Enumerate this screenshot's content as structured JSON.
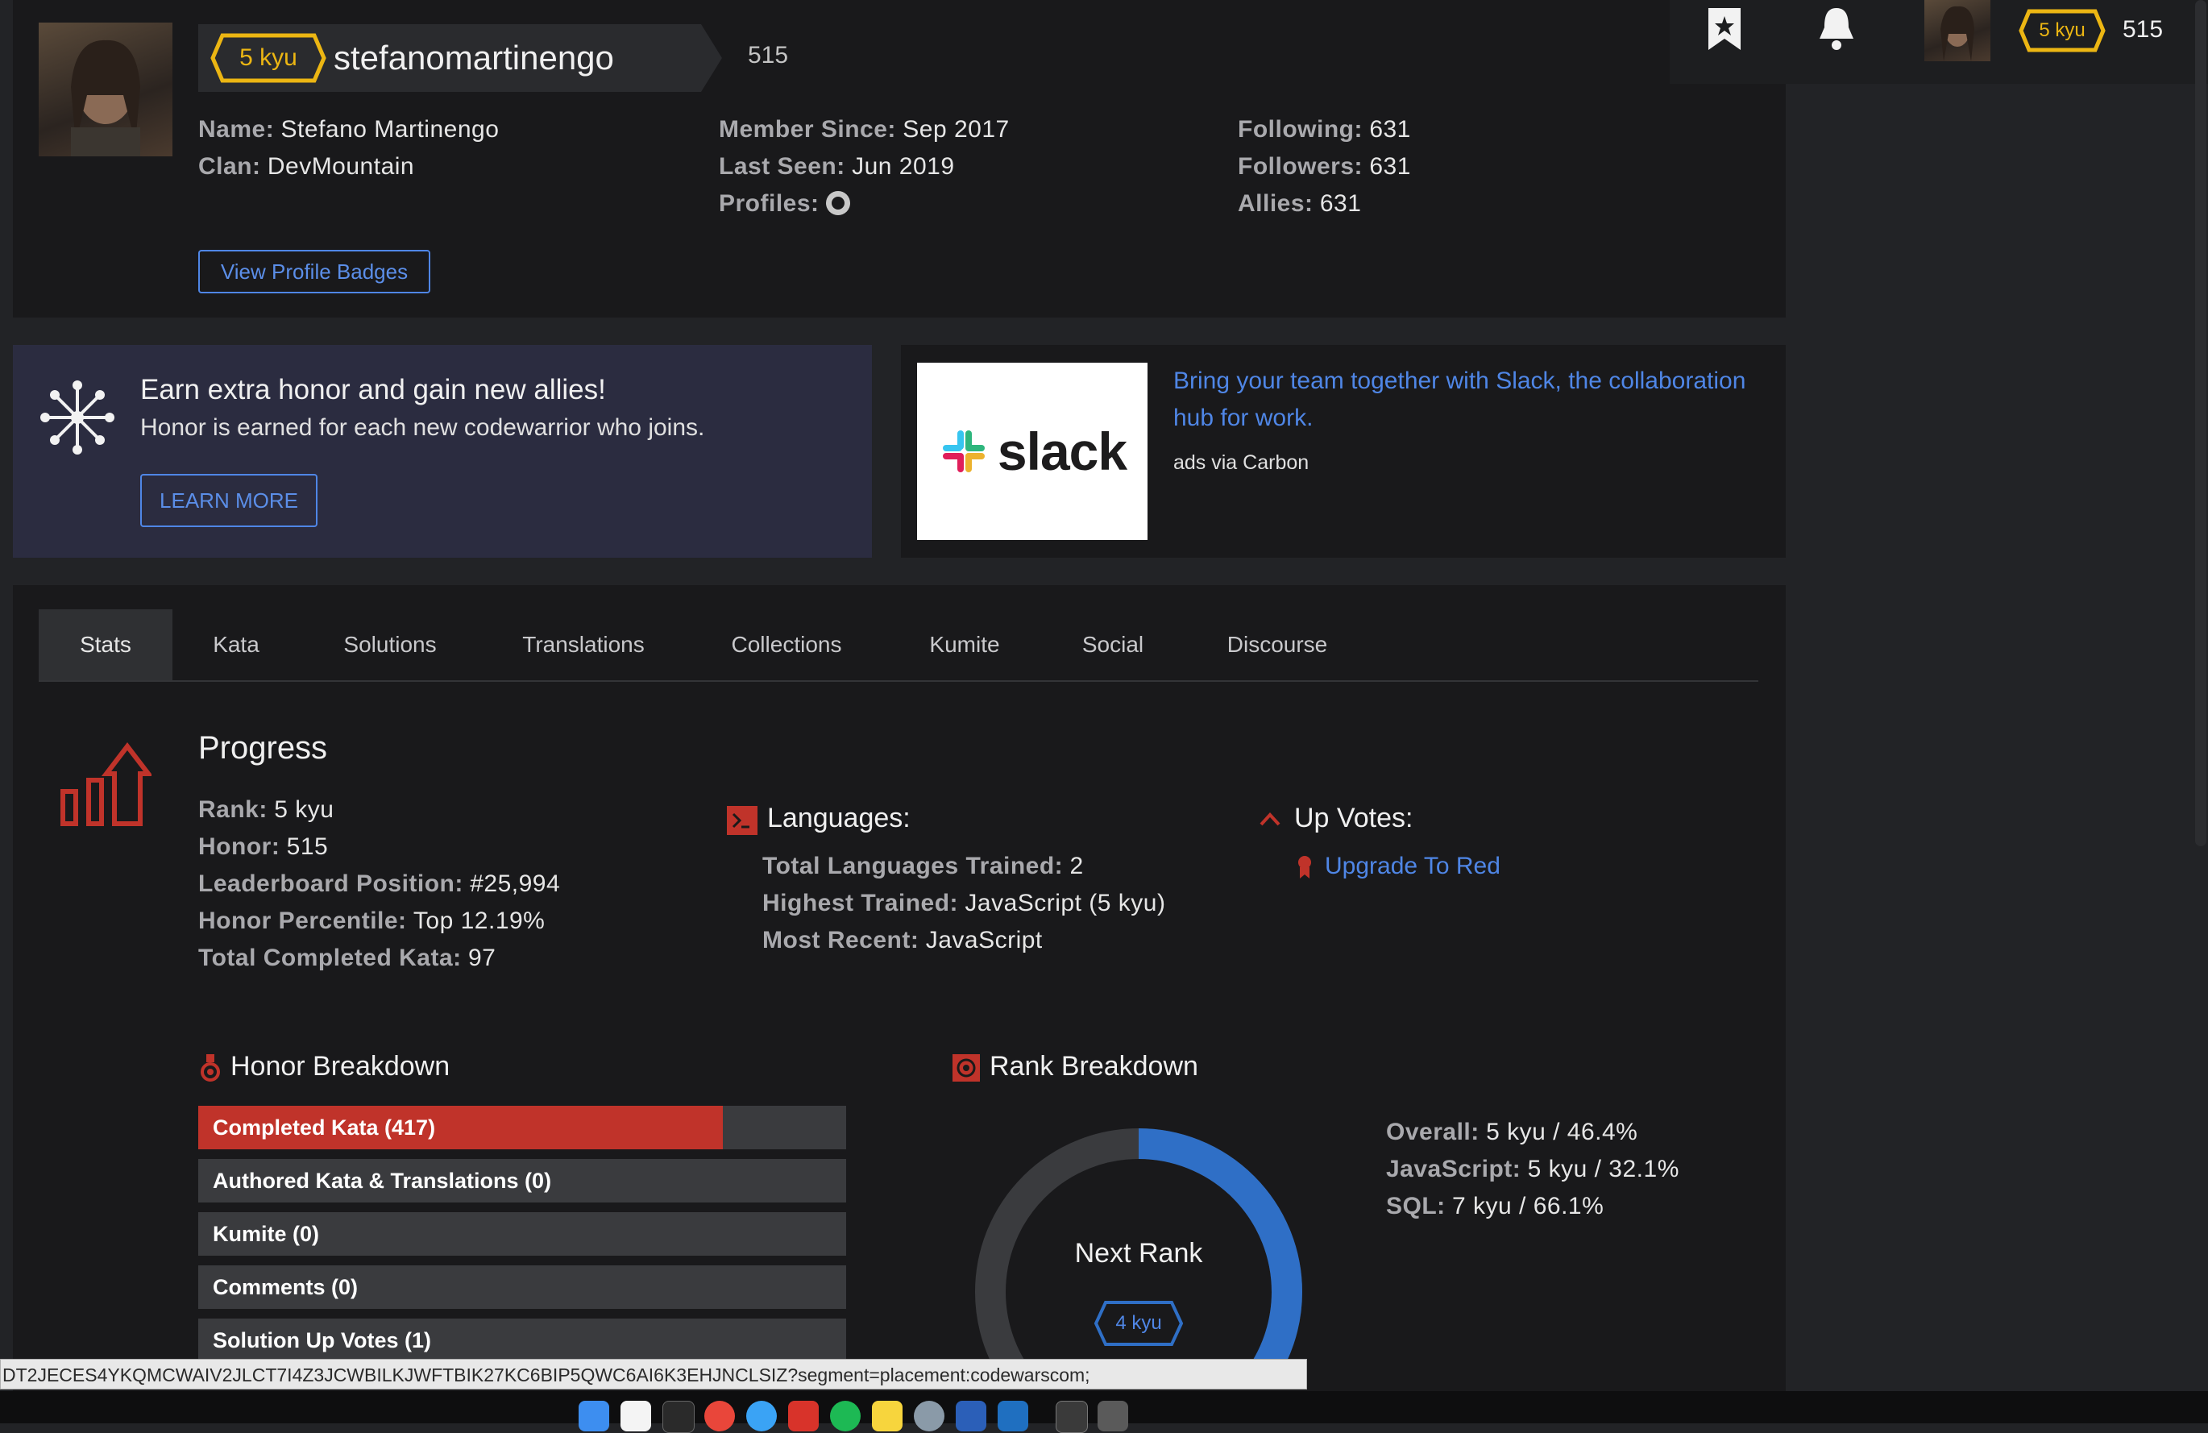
{
  "profile": {
    "rank_badge": "5 kyu",
    "username": "stefanomartinengo",
    "honor": "515",
    "name_label": "Name:",
    "name": "Stefano Martinengo",
    "clan_label": "Clan:",
    "clan": "DevMountain",
    "member_since_label": "Member Since:",
    "member_since": "Sep 2017",
    "last_seen_label": "Last Seen:",
    "last_seen": "Jun 2019",
    "profiles_label": "Profiles:",
    "following_label": "Following:",
    "following": "631",
    "followers_label": "Followers:",
    "followers": "631",
    "allies_label": "Allies:",
    "allies": "631",
    "badges_button": "View Profile Badges"
  },
  "topbar": {
    "rank_badge": "5 kyu",
    "honor": "515"
  },
  "promo": {
    "title": "Earn extra honor and gain new allies!",
    "subtitle": "Honor is earned for each new codewarrior who joins.",
    "button": "LEARN MORE"
  },
  "ad": {
    "logo_text": "slack",
    "text": "Bring your team together with Slack, the collaboration hub for work.",
    "via": "ads via Carbon"
  },
  "tabs": [
    "Stats",
    "Kata",
    "Solutions",
    "Translations",
    "Collections",
    "Kumite",
    "Social",
    "Discourse"
  ],
  "progress": {
    "title": "Progress",
    "rank_label": "Rank:",
    "rank": "5 kyu",
    "honor_label": "Honor:",
    "honor": "515",
    "leaderboard_label": "Leaderboard Position:",
    "leaderboard": "#25,994",
    "percentile_label": "Honor Percentile:",
    "percentile": "Top 12.19%",
    "completed_label": "Total Completed Kata:",
    "completed": "97"
  },
  "languages": {
    "title": "Languages:",
    "trained_label": "Total Languages Trained:",
    "trained": "2",
    "highest_label": "Highest Trained:",
    "highest": "JavaScript (5 kyu)",
    "recent_label": "Most Recent:",
    "recent": "JavaScript"
  },
  "upvotes": {
    "title": "Up Votes:",
    "link": "Upgrade To Red"
  },
  "honor_breakdown": {
    "title": "Honor Breakdown",
    "items": [
      {
        "label": "Completed Kata (417)",
        "fill": 0.81
      },
      {
        "label": "Authored Kata & Translations (0)",
        "fill": 0
      },
      {
        "label": "Kumite (0)",
        "fill": 0
      },
      {
        "label": "Comments (0)",
        "fill": 0
      },
      {
        "label": "Solution Up Votes (1)",
        "fill": 0
      }
    ]
  },
  "rank_breakdown": {
    "title": "Rank Breakdown",
    "next_rank_label": "Next Rank",
    "next_rank": "4 kyu",
    "progress": 0.464,
    "overall_label": "Overall:",
    "overall": "5 kyu / 46.4%",
    "js_label": "JavaScript:",
    "js": "5 kyu / 32.1%",
    "sql_label": "SQL:",
    "sql": "7 kyu / 66.1%"
  },
  "status_url": "DT2JECES4YKQMCWAIV2JLCT7I4Z3JCWBILKJWFTBIK27KC6BIP5QWC6AI6K3EHJNCLSIZ?segment=placement:codewarscom;",
  "colors": {
    "accent_blue": "#4f86e6",
    "kyu_yellow": "#ecb613",
    "danger_red": "#c0332a"
  }
}
